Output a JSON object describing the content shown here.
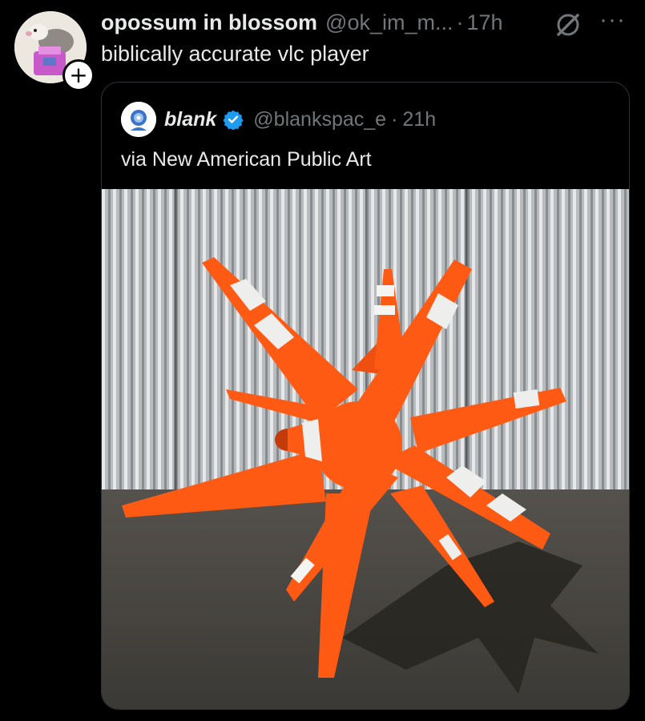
{
  "post": {
    "display_name": "opossum in blossom",
    "handle": "@ok_im_m...",
    "separator": "·",
    "time": "17h",
    "text": "biblically accurate vlc player",
    "follow_symbol": "+"
  },
  "quote": {
    "display_name": "blank",
    "handle": "@blankspac_e",
    "separator": "·",
    "time": "21h",
    "text": "via New American Public Art"
  },
  "icons": {
    "grok": "grok-icon",
    "more": "more-icon",
    "verified": "verified-badge-icon"
  },
  "colors": {
    "background": "#000000",
    "text": "#e7e9ea",
    "secondary": "#71767b",
    "verified": "#1d9bf0",
    "cone": "#ff5a14",
    "border": "#2f3336"
  }
}
